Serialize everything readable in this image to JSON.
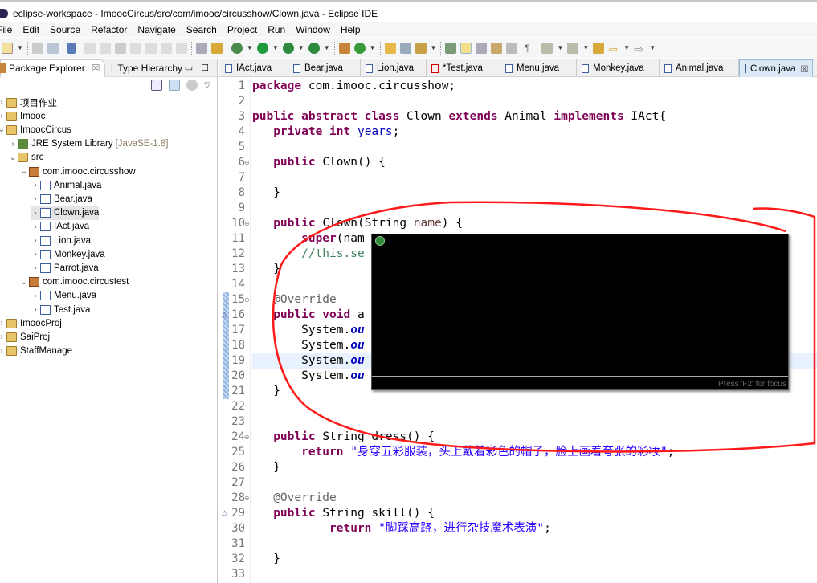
{
  "window": {
    "title": "eclipse-workspace - ImoocCircus/src/com/imooc/circusshow/Clown.java - Eclipse IDE"
  },
  "menu": [
    "File",
    "Edit",
    "Source",
    "Refactor",
    "Navigate",
    "Search",
    "Project",
    "Run",
    "Window",
    "Help"
  ],
  "left_panel": {
    "tabs": [
      "Package Explorer",
      "Type Hierarchy"
    ],
    "tree": [
      {
        "label": "项目作业",
        "depth": 0,
        "twisty": ">",
        "icon": "project-folder-icon"
      },
      {
        "label": "Imooc",
        "depth": 0,
        "twisty": ">",
        "icon": "project-error-icon"
      },
      {
        "label": "ImoocCircus",
        "depth": 0,
        "twisty": "v",
        "icon": "project-error-icon"
      },
      {
        "label": "JRE System Library",
        "extra": "[JavaSE-1.8]",
        "depth": 1,
        "twisty": ">",
        "icon": "library-icon"
      },
      {
        "label": "src",
        "depth": 1,
        "twisty": "v",
        "icon": "source-folder-icon"
      },
      {
        "label": "com.imooc.circusshow",
        "depth": 2,
        "twisty": "v",
        "icon": "package-error-icon"
      },
      {
        "label": "Animal.java",
        "depth": 3,
        "twisty": ">",
        "icon": "abstract-java-file-icon"
      },
      {
        "label": "Bear.java",
        "depth": 3,
        "twisty": ">",
        "icon": "java-file-icon"
      },
      {
        "label": "Clown.java",
        "depth": 3,
        "twisty": ">",
        "icon": "abstract-java-file-icon",
        "selected": true
      },
      {
        "label": "IAct.java",
        "depth": 3,
        "twisty": ">",
        "icon": "interface-file-icon"
      },
      {
        "label": "Lion.java",
        "depth": 3,
        "twisty": ">",
        "icon": "java-file-icon"
      },
      {
        "label": "Monkey.java",
        "depth": 3,
        "twisty": ">",
        "icon": "java-file-icon"
      },
      {
        "label": "Parrot.java",
        "depth": 3,
        "twisty": ">",
        "icon": "java-file-error-icon"
      },
      {
        "label": "com.imooc.circustest",
        "depth": 2,
        "twisty": "v",
        "icon": "package-error-icon"
      },
      {
        "label": "Menu.java",
        "depth": 3,
        "twisty": ">",
        "icon": "java-file-icon"
      },
      {
        "label": "Test.java",
        "depth": 3,
        "twisty": ">",
        "icon": "java-file-error-icon"
      },
      {
        "label": "ImoocProj",
        "depth": 0,
        "twisty": ">",
        "icon": "project-error-icon"
      },
      {
        "label": "SaiProj",
        "depth": 0,
        "twisty": ">",
        "icon": "project-error-icon"
      },
      {
        "label": "StaffManage",
        "depth": 0,
        "twisty": ">",
        "icon": "project-error-icon"
      }
    ]
  },
  "editor": {
    "tabs": [
      {
        "label": "IAct.java"
      },
      {
        "label": "Bear.java"
      },
      {
        "label": "Lion.java"
      },
      {
        "label": "*Test.java",
        "error": true
      },
      {
        "label": "Menu.java"
      },
      {
        "label": "Monkey.java"
      },
      {
        "label": "Animal.java"
      },
      {
        "label": "Clown.java",
        "active": true
      }
    ],
    "current_line": 19,
    "lines": [
      [
        [
          "kw",
          "package"
        ],
        [
          "",
          "  com.imooc.circusshow;"
        ]
      ],
      [],
      [
        [
          "kw",
          "public abstract class"
        ],
        [
          "",
          "  Clown "
        ],
        [
          "kw",
          "extends"
        ],
        [
          "",
          "  Animal "
        ],
        [
          "kw",
          "implements"
        ],
        [
          "",
          "  IAct{"
        ]
      ],
      [
        [
          "",
          "    "
        ],
        [
          "kw",
          "private int"
        ],
        [
          "",
          "  "
        ],
        [
          "fd",
          "years"
        ],
        [
          "",
          ";"
        ]
      ],
      [],
      [
        [
          "",
          "    "
        ],
        [
          "kw",
          "public"
        ],
        [
          "",
          "  Clown() {"
        ]
      ],
      [],
      [
        [
          "",
          "    }"
        ]
      ],
      [],
      [
        [
          "",
          "    "
        ],
        [
          "kw",
          "public"
        ],
        [
          "",
          "  Clown(String "
        ],
        [
          "pm",
          "name"
        ],
        [
          "",
          ") {"
        ]
      ],
      [
        [
          "",
          "        "
        ],
        [
          "kw",
          "super"
        ],
        [
          "",
          "(nam"
        ]
      ],
      [
        [
          "",
          "        "
        ],
        [
          "cm",
          "//this.se"
        ]
      ],
      [
        [
          "",
          "    }"
        ]
      ],
      [],
      [
        [
          "",
          "    "
        ],
        [
          "an",
          "@Override"
        ]
      ],
      [
        [
          "",
          "    "
        ],
        [
          "kw",
          "public void"
        ],
        [
          "",
          "  a"
        ]
      ],
      [
        [
          "",
          "        System."
        ],
        [
          "fi",
          "ou"
        ]
      ],
      [
        [
          "",
          "        System."
        ],
        [
          "fi",
          "ou"
        ]
      ],
      [
        [
          "",
          "        System."
        ],
        [
          "fi",
          "ou"
        ]
      ],
      [
        [
          "",
          "        System."
        ],
        [
          "fi",
          "ou"
        ]
      ],
      [
        [
          "",
          "    }"
        ]
      ],
      [],
      [],
      [
        [
          "",
          "    "
        ],
        [
          "kw",
          "public"
        ],
        [
          "",
          "  String dress() {"
        ]
      ],
      [
        [
          "",
          "        "
        ],
        [
          "kw",
          "return"
        ],
        [
          "",
          "  "
        ],
        [
          "st",
          "\"身穿五彩服装，头上戴着彩色的帽子，脸上画着夸张的彩妆\""
        ],
        [
          "",
          ";"
        ]
      ],
      [
        [
          "",
          "    }"
        ]
      ],
      [],
      [
        [
          "",
          "    "
        ],
        [
          "an",
          "@Override"
        ]
      ],
      [
        [
          "",
          "    "
        ],
        [
          "kw",
          "public"
        ],
        [
          "",
          "  String skill() {"
        ]
      ],
      [
        [
          "",
          "            "
        ],
        [
          "kw",
          "return"
        ],
        [
          "",
          "  "
        ],
        [
          "st",
          "\"脚踩高跷，进行杂技魔术表演\""
        ],
        [
          "",
          ";"
        ]
      ],
      [],
      [
        [
          "",
          "    }"
        ]
      ],
      []
    ],
    "fold_lines": [
      6,
      10,
      15,
      24,
      28
    ],
    "override_lines": [
      16,
      29
    ]
  },
  "popup": {
    "hint": "Press 'F2' for focus"
  },
  "annotation_color": "#ff0000"
}
